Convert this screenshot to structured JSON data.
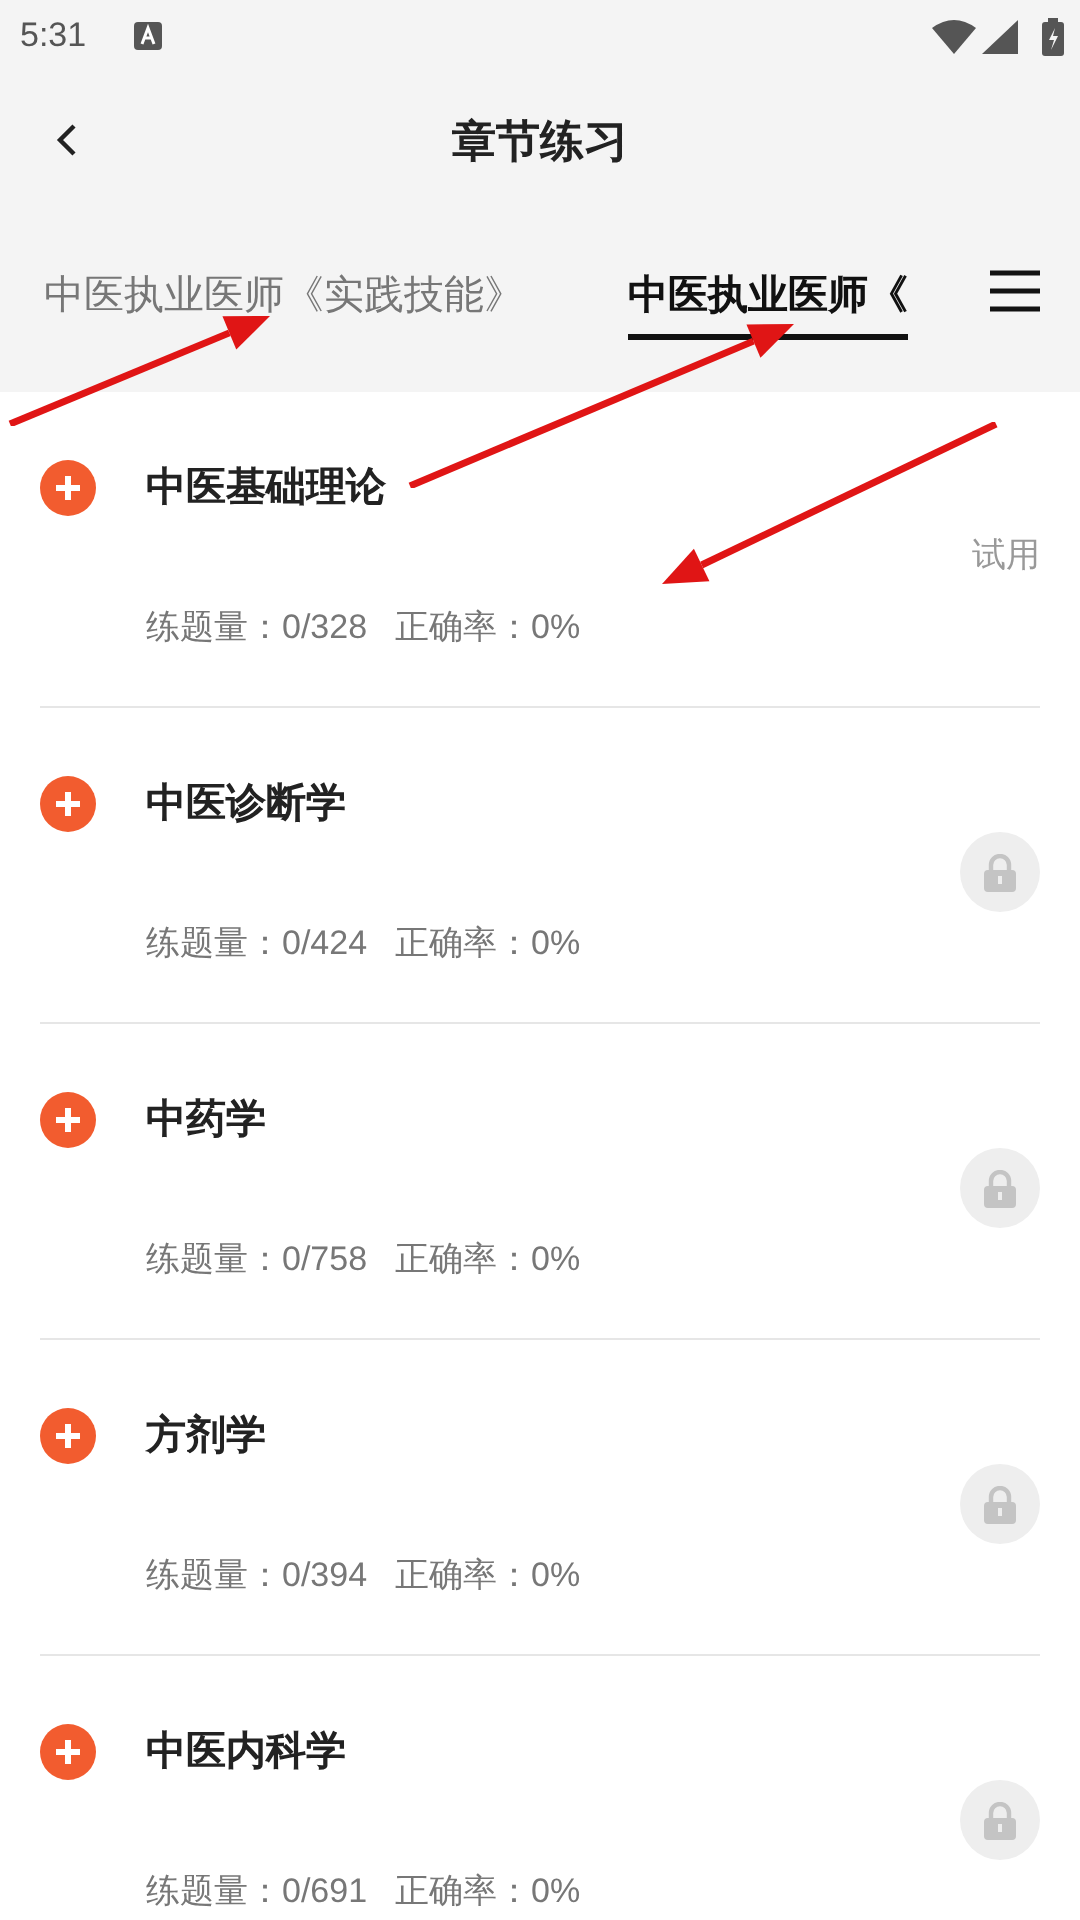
{
  "status_bar": {
    "time": "5:31"
  },
  "header": {
    "title": "章节练习"
  },
  "tabs": [
    {
      "label": "中医执业医师《实践技能》",
      "selected": false
    },
    {
      "label": "中医执业医师《",
      "selected": true
    }
  ],
  "chapters": [
    {
      "title": "中医基础理论",
      "kind": "trial",
      "badge": "试用",
      "count": "练题量：0/328",
      "accuracy": "正确率：0%"
    },
    {
      "title": "中医诊断学",
      "kind": "locked",
      "count": "练题量：0/424",
      "accuracy": "正确率：0%"
    },
    {
      "title": "中药学",
      "kind": "locked",
      "count": "练题量：0/758",
      "accuracy": "正确率：0%"
    },
    {
      "title": "方剂学",
      "kind": "locked",
      "count": "练题量：0/394",
      "accuracy": "正确率：0%"
    },
    {
      "title": "中医内科学",
      "kind": "locked",
      "count": "练题量：0/691",
      "accuracy": "正确率：0%"
    }
  ]
}
